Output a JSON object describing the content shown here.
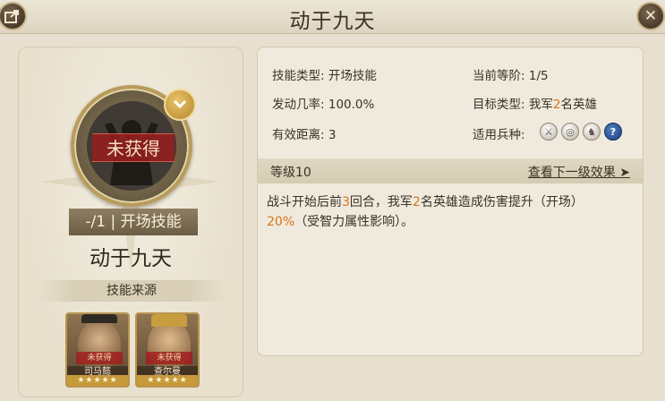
{
  "window": {
    "title": "动于九天",
    "left_button_icon": "share-icon",
    "close_button_icon": "close-icon",
    "close_glyph": "✕"
  },
  "left": {
    "status_text": "未获得",
    "level_type": "-/1 | 开场技能",
    "skill_name": "动于九天",
    "source_label": "技能来源",
    "heroes": [
      {
        "tag": "未获得",
        "name": "司马懿",
        "stars": "★★★★★"
      },
      {
        "tag": "未获得",
        "name": "查尔曼",
        "stars": "★★★★★"
      }
    ]
  },
  "details": {
    "skill_type_label": "技能类型:",
    "skill_type_value": "开场技能",
    "current_rank_label": "当前等阶:",
    "current_rank_value": "1/5",
    "trigger_rate_label": "发动几率:",
    "trigger_rate_value": "100.0%",
    "target_type_label": "目标类型:",
    "target_type_prefix": "我军",
    "target_type_count": "2",
    "target_type_suffix": "名英雄",
    "range_label": "有效距离:",
    "range_value": "3",
    "troop_label": "适用兵种:",
    "troop_icons": [
      "sword-icon",
      "shield-icon",
      "horse-icon",
      "question-icon"
    ],
    "troop_glyphs": [
      "⚔",
      "◎",
      "♞",
      "?"
    ]
  },
  "level": {
    "label": "等级10",
    "next_link": "查看下一级效果 ➤"
  },
  "description": {
    "part1": "战斗开始后前",
    "num1": "3",
    "part2": "回合，我军",
    "num2": "2",
    "part3": "名英雄造成伤害提升（开场）",
    "num3": "20%",
    "part4": "（受智力属性影响）。"
  },
  "colors": {
    "highlight": "#d8751a",
    "panel_bg": "#efeadd",
    "status_red": "#962020"
  }
}
